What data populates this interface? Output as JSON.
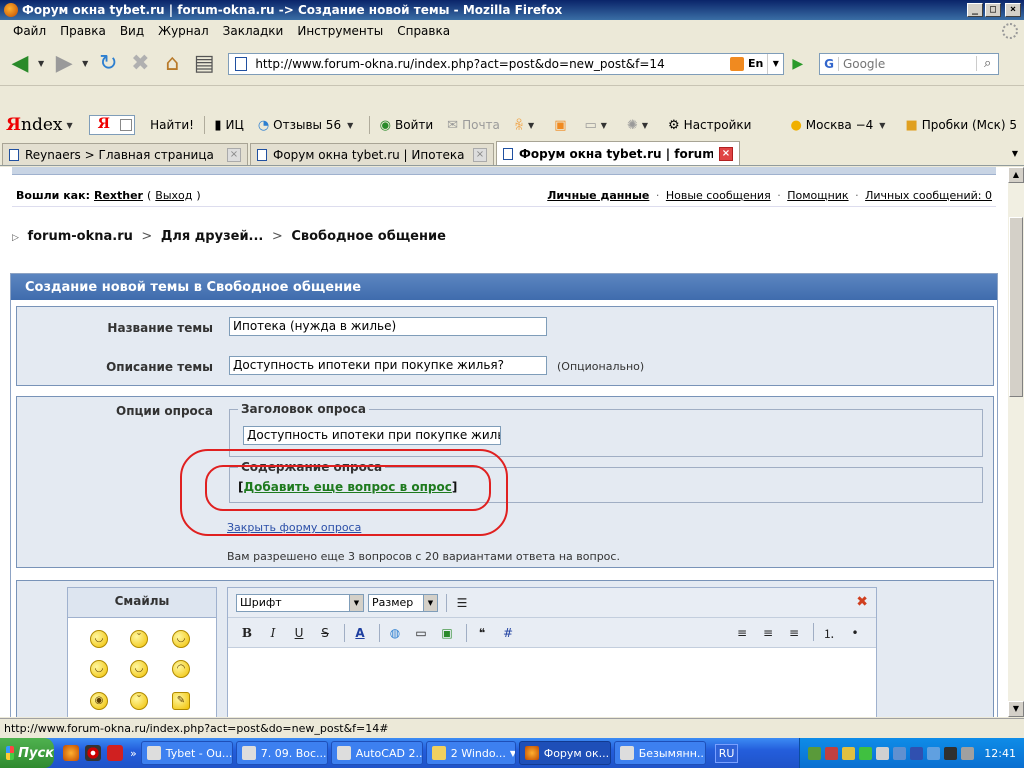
{
  "window": {
    "title": "Форум окна tybet.ru | forum-okna.ru -> Создание новой темы - Mozilla Firefox",
    "minimize": "_",
    "maximize": "□",
    "close": "×"
  },
  "menu": [
    "Файл",
    "Правка",
    "Вид",
    "Журнал",
    "Закладки",
    "Инструменты",
    "Справка"
  ],
  "nav": {
    "url": "http://www.forum-okna.ru/index.php?act=post&do=new_post&f=14",
    "lang_badge": "En",
    "search_placeholder": "Google",
    "search_engine_glyph": "G"
  },
  "yandex": {
    "logo_first": "Я",
    "logo_rest": "ndex",
    "input_logo": "Я",
    "find_label": "Найти!",
    "ic_label": "ИЦ",
    "reviews_label": "Отзывы 56",
    "login_label": "Войти",
    "mail_label": "Почта",
    "settings_label": "Настройки",
    "weather_label": "Москва −4",
    "traffic_label": "Пробки (Мск) 5"
  },
  "tabs": [
    {
      "label": "Reynaers > Главная страница",
      "active": false
    },
    {
      "label": "Форум окна tybet.ru | Ипотека - for...",
      "active": false
    },
    {
      "label": "Форум окна tybet.ru | forum-ok...",
      "active": true
    }
  ],
  "userbar": {
    "logged_in_label": "Вошли как:",
    "user_name": "Rexther",
    "open_paren": "(",
    "logout": "Выход",
    "close_paren": ")",
    "links": [
      "Личные данные",
      "Новые сообщения",
      "Помощник",
      "Личных сообщений: 0"
    ],
    "dot": "·"
  },
  "breadcrumb": {
    "items": [
      "forum-okna.ru",
      "Для друзей...",
      "Свободное общение"
    ],
    "separator": ">",
    "marker": "▷"
  },
  "form": {
    "header": "Создание новой темы в Свободное общение",
    "topic_title_label": "Название темы",
    "topic_title_value": "Ипотека (нужда в жилье)",
    "topic_desc_label": "Описание темы",
    "topic_desc_value": "Доступность ипотеки при покупке жилья?",
    "optional_note": "(Опционально)",
    "poll_options_label": "Опции опроса",
    "poll_title_legend": "Заголовок опроса",
    "poll_title_value": "Доступность ипотеки при покупке жилья?",
    "poll_content_legend": "Содержание опроса",
    "bracket_open": "[",
    "add_question_link": "Добавить еще вопрос в опрос",
    "bracket_close": "]",
    "close_poll_link": "Закрыть форму опроса",
    "allowed_note": "Вам разрешено еще 3 вопросов с 20 вариантами ответа на вопрос."
  },
  "smilies": {
    "title": "Смайлы",
    "faces": [
      "◡",
      "˘",
      "◡",
      "◡",
      "◡",
      "◠",
      "◉",
      "˘",
      "✎"
    ]
  },
  "editor": {
    "font_select": "Шрифт",
    "size_select": "Размер",
    "bold": "B",
    "italic": "I",
    "underline": "U",
    "strike": "S",
    "color": "A",
    "close": "✖"
  },
  "status": {
    "text": "http://www.forum-okna.ru/index.php?act=post&do=new_post&f=14#"
  },
  "taskbar": {
    "start": "Пуск",
    "more": "»",
    "tasks": [
      {
        "label": "Tybet - Ou...",
        "active": false
      },
      {
        "label": "7. 09. Вос...",
        "active": false
      },
      {
        "label": "AutoCAD 2...",
        "active": false
      },
      {
        "label": "2 Windo...",
        "active": false,
        "dropdown": true
      },
      {
        "label": "Форум ок...",
        "active": true
      },
      {
        "label": "Безымянн...",
        "active": false
      }
    ],
    "lang": "RU",
    "clock": "12:41"
  },
  "colors": {
    "form_header": "#3F6CAD",
    "panel_bg": "#E4EAF2",
    "annotation_red": "#E02020",
    "add_link_green": "#1E7A1E"
  }
}
